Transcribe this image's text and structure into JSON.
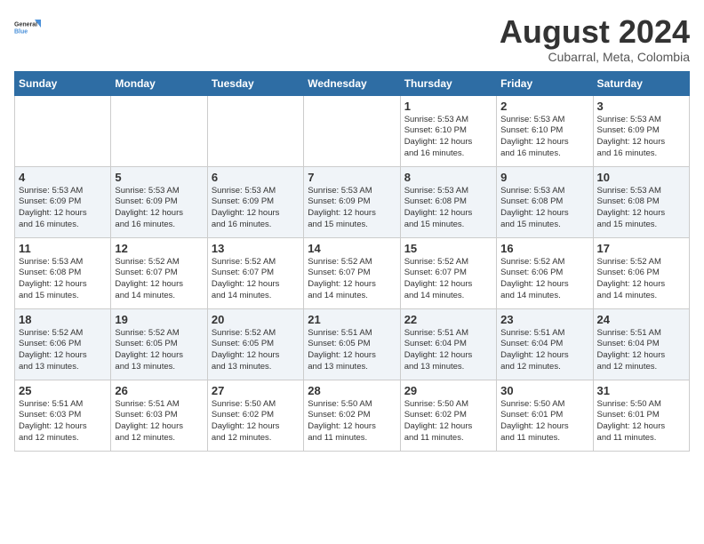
{
  "logo": {
    "line1": "General",
    "line2": "Blue"
  },
  "title": "August 2024",
  "location": "Cubarral, Meta, Colombia",
  "days_of_week": [
    "Sunday",
    "Monday",
    "Tuesday",
    "Wednesday",
    "Thursday",
    "Friday",
    "Saturday"
  ],
  "weeks": [
    [
      {
        "day": "",
        "detail": ""
      },
      {
        "day": "",
        "detail": ""
      },
      {
        "day": "",
        "detail": ""
      },
      {
        "day": "",
        "detail": ""
      },
      {
        "day": "1",
        "detail": "Sunrise: 5:53 AM\nSunset: 6:10 PM\nDaylight: 12 hours\nand 16 minutes."
      },
      {
        "day": "2",
        "detail": "Sunrise: 5:53 AM\nSunset: 6:10 PM\nDaylight: 12 hours\nand 16 minutes."
      },
      {
        "day": "3",
        "detail": "Sunrise: 5:53 AM\nSunset: 6:09 PM\nDaylight: 12 hours\nand 16 minutes."
      }
    ],
    [
      {
        "day": "4",
        "detail": "Sunrise: 5:53 AM\nSunset: 6:09 PM\nDaylight: 12 hours\nand 16 minutes."
      },
      {
        "day": "5",
        "detail": "Sunrise: 5:53 AM\nSunset: 6:09 PM\nDaylight: 12 hours\nand 16 minutes."
      },
      {
        "day": "6",
        "detail": "Sunrise: 5:53 AM\nSunset: 6:09 PM\nDaylight: 12 hours\nand 16 minutes."
      },
      {
        "day": "7",
        "detail": "Sunrise: 5:53 AM\nSunset: 6:09 PM\nDaylight: 12 hours\nand 15 minutes."
      },
      {
        "day": "8",
        "detail": "Sunrise: 5:53 AM\nSunset: 6:08 PM\nDaylight: 12 hours\nand 15 minutes."
      },
      {
        "day": "9",
        "detail": "Sunrise: 5:53 AM\nSunset: 6:08 PM\nDaylight: 12 hours\nand 15 minutes."
      },
      {
        "day": "10",
        "detail": "Sunrise: 5:53 AM\nSunset: 6:08 PM\nDaylight: 12 hours\nand 15 minutes."
      }
    ],
    [
      {
        "day": "11",
        "detail": "Sunrise: 5:53 AM\nSunset: 6:08 PM\nDaylight: 12 hours\nand 15 minutes."
      },
      {
        "day": "12",
        "detail": "Sunrise: 5:52 AM\nSunset: 6:07 PM\nDaylight: 12 hours\nand 14 minutes."
      },
      {
        "day": "13",
        "detail": "Sunrise: 5:52 AM\nSunset: 6:07 PM\nDaylight: 12 hours\nand 14 minutes."
      },
      {
        "day": "14",
        "detail": "Sunrise: 5:52 AM\nSunset: 6:07 PM\nDaylight: 12 hours\nand 14 minutes."
      },
      {
        "day": "15",
        "detail": "Sunrise: 5:52 AM\nSunset: 6:07 PM\nDaylight: 12 hours\nand 14 minutes."
      },
      {
        "day": "16",
        "detail": "Sunrise: 5:52 AM\nSunset: 6:06 PM\nDaylight: 12 hours\nand 14 minutes."
      },
      {
        "day": "17",
        "detail": "Sunrise: 5:52 AM\nSunset: 6:06 PM\nDaylight: 12 hours\nand 14 minutes."
      }
    ],
    [
      {
        "day": "18",
        "detail": "Sunrise: 5:52 AM\nSunset: 6:06 PM\nDaylight: 12 hours\nand 13 minutes."
      },
      {
        "day": "19",
        "detail": "Sunrise: 5:52 AM\nSunset: 6:05 PM\nDaylight: 12 hours\nand 13 minutes."
      },
      {
        "day": "20",
        "detail": "Sunrise: 5:52 AM\nSunset: 6:05 PM\nDaylight: 12 hours\nand 13 minutes."
      },
      {
        "day": "21",
        "detail": "Sunrise: 5:51 AM\nSunset: 6:05 PM\nDaylight: 12 hours\nand 13 minutes."
      },
      {
        "day": "22",
        "detail": "Sunrise: 5:51 AM\nSunset: 6:04 PM\nDaylight: 12 hours\nand 13 minutes."
      },
      {
        "day": "23",
        "detail": "Sunrise: 5:51 AM\nSunset: 6:04 PM\nDaylight: 12 hours\nand 12 minutes."
      },
      {
        "day": "24",
        "detail": "Sunrise: 5:51 AM\nSunset: 6:04 PM\nDaylight: 12 hours\nand 12 minutes."
      }
    ],
    [
      {
        "day": "25",
        "detail": "Sunrise: 5:51 AM\nSunset: 6:03 PM\nDaylight: 12 hours\nand 12 minutes."
      },
      {
        "day": "26",
        "detail": "Sunrise: 5:51 AM\nSunset: 6:03 PM\nDaylight: 12 hours\nand 12 minutes."
      },
      {
        "day": "27",
        "detail": "Sunrise: 5:50 AM\nSunset: 6:02 PM\nDaylight: 12 hours\nand 12 minutes."
      },
      {
        "day": "28",
        "detail": "Sunrise: 5:50 AM\nSunset: 6:02 PM\nDaylight: 12 hours\nand 11 minutes."
      },
      {
        "day": "29",
        "detail": "Sunrise: 5:50 AM\nSunset: 6:02 PM\nDaylight: 12 hours\nand 11 minutes."
      },
      {
        "day": "30",
        "detail": "Sunrise: 5:50 AM\nSunset: 6:01 PM\nDaylight: 12 hours\nand 11 minutes."
      },
      {
        "day": "31",
        "detail": "Sunrise: 5:50 AM\nSunset: 6:01 PM\nDaylight: 12 hours\nand 11 minutes."
      }
    ]
  ]
}
